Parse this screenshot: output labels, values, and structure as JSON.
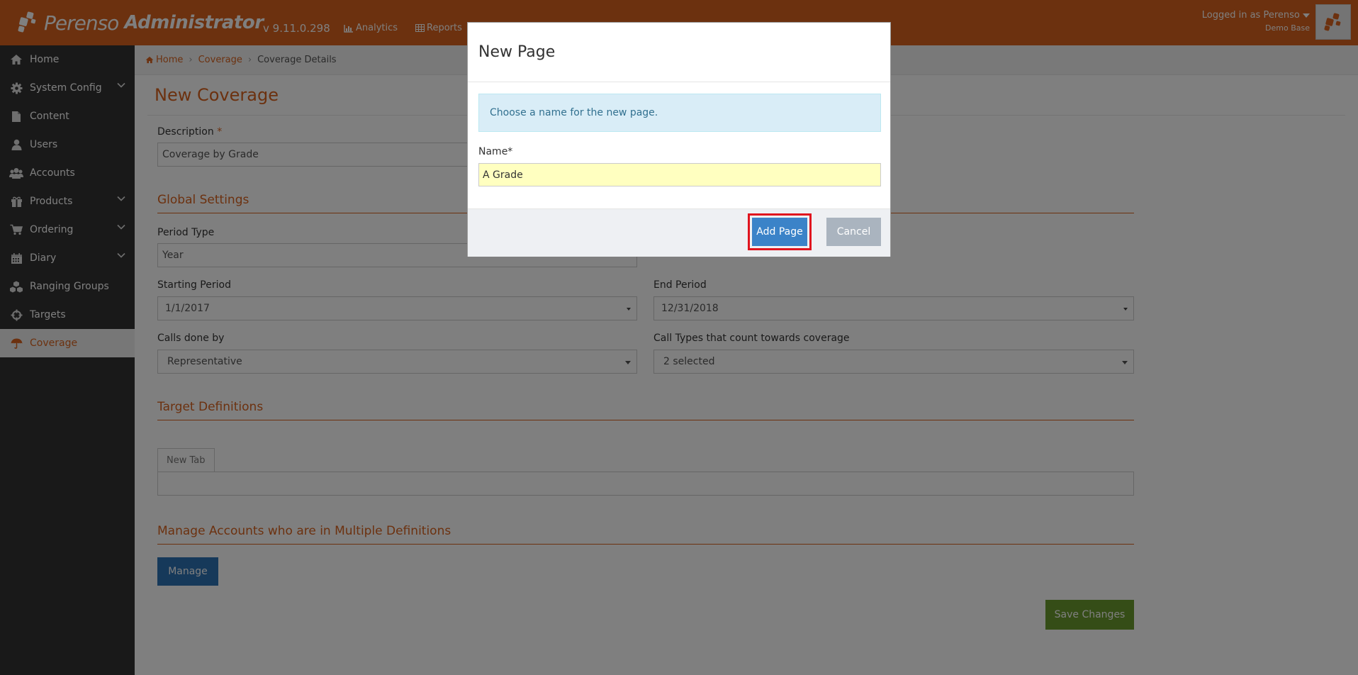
{
  "header": {
    "logo_word1": "Perenso",
    "logo_word2": "Administrator",
    "version": "v 9.11.0.298",
    "nav": [
      {
        "label": "Analytics",
        "icon": "bar-chart-icon"
      },
      {
        "label": "Reports",
        "icon": "table-icon"
      }
    ],
    "user_line": "Logged in as Perenso",
    "user_sub": "Demo Base"
  },
  "sidebar": {
    "items": [
      {
        "label": "Home",
        "icon": "home-icon",
        "expandable": false
      },
      {
        "label": "System Config",
        "icon": "gear-icon",
        "expandable": true
      },
      {
        "label": "Content",
        "icon": "file-icon",
        "expandable": false
      },
      {
        "label": "Users",
        "icon": "user-icon",
        "expandable": false
      },
      {
        "label": "Accounts",
        "icon": "users-icon",
        "expandable": false
      },
      {
        "label": "Products",
        "icon": "gift-icon",
        "expandable": true
      },
      {
        "label": "Ordering",
        "icon": "cart-icon",
        "expandable": true
      },
      {
        "label": "Diary",
        "icon": "calendar-icon",
        "expandable": true
      },
      {
        "label": "Ranging Groups",
        "icon": "cubes-icon",
        "expandable": false
      },
      {
        "label": "Targets",
        "icon": "crosshairs-icon",
        "expandable": false
      },
      {
        "label": "Coverage",
        "icon": "umbrella-icon",
        "expandable": false,
        "active": true
      }
    ]
  },
  "breadcrumb": {
    "home": "Home",
    "coverage": "Coverage",
    "current": "Coverage Details"
  },
  "page": {
    "title": "New Coverage",
    "description_label": "Description",
    "required_mark": "*",
    "description_value": "Coverage by Grade",
    "global_settings_title": "Global Settings",
    "period_type_label": "Period Type",
    "period_type_value": "Year",
    "starting_period_label": "Starting Period",
    "starting_period_value": "1/1/2017",
    "end_period_label": "End Period",
    "end_period_value": "12/31/2018",
    "calls_done_by_label": "Calls done by",
    "calls_done_by_value": "Representative",
    "call_types_label": "Call Types that count towards coverage",
    "call_types_value": "2 selected",
    "target_definitions_title": "Target Definitions",
    "new_tab_label": "New Tab",
    "manage_accounts_title": "Manage Accounts who are in Multiple Definitions",
    "manage_button": "Manage",
    "save_button": "Save Changes"
  },
  "modal": {
    "title": "New Page",
    "info_text": "Choose a name for the new page.",
    "name_label": "Name*",
    "name_value": "A Grade",
    "add_button": "Add Page",
    "cancel_button": "Cancel"
  },
  "colors": {
    "brand": "#d9631e",
    "sidebar_bg": "#333333",
    "primary_button": "#3b83c8",
    "save_button": "#6b9a2f",
    "highlight": "#e0141e"
  }
}
